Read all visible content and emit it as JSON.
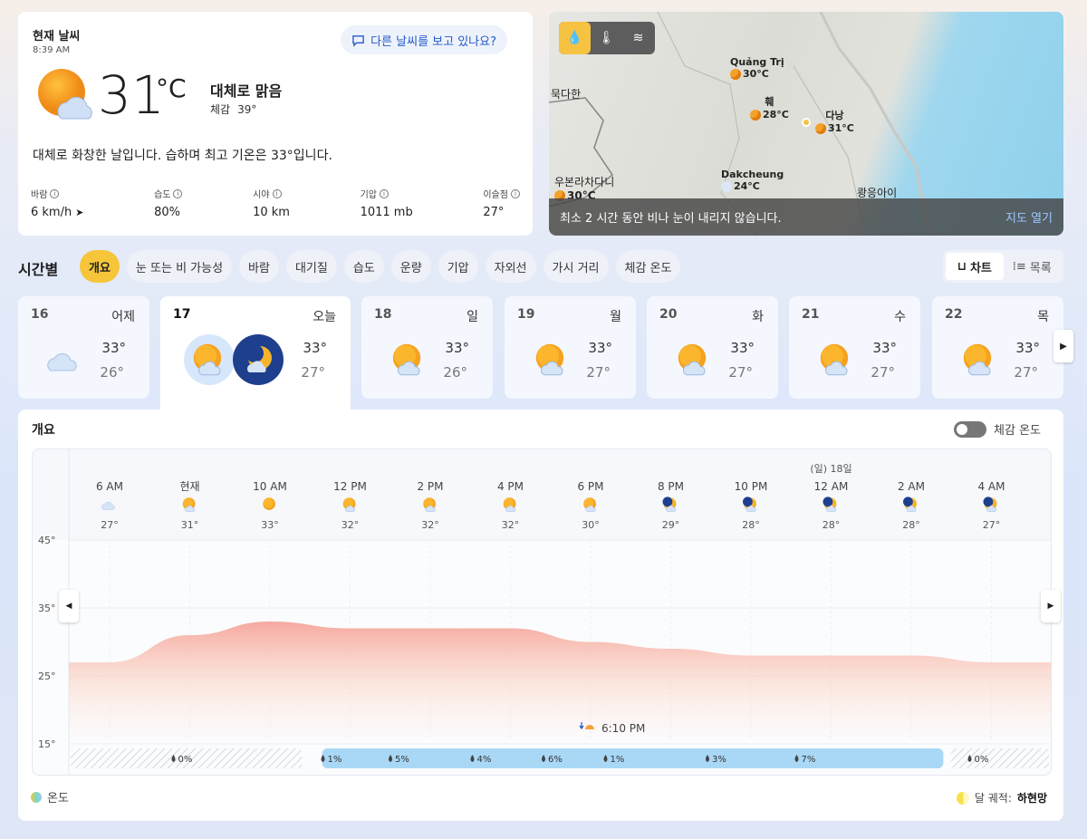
{
  "current": {
    "title": "현재 날씨",
    "time": "8:39 AM",
    "feedback_label": "다른 날씨를 보고 있나요?",
    "temp": "31",
    "unit": "°C",
    "condition": "대체로 맑음",
    "feels_label": "체감",
    "feels_value": "39°",
    "summary": "대체로 화창한 날입니다. 습하며 최고 기온은 33°입니다.",
    "stats": [
      {
        "label": "바람",
        "value": "6 km/h"
      },
      {
        "label": "습도",
        "value": "80%"
      },
      {
        "label": "시야",
        "value": "10 km"
      },
      {
        "label": "기압",
        "value": "1011 mb"
      },
      {
        "label": "이슬점",
        "value": "27°"
      }
    ]
  },
  "map": {
    "cities": [
      {
        "name": "Quảng Trị",
        "temp": "30°C"
      },
      {
        "name": "훼",
        "temp": "28°C"
      },
      {
        "name": "다낭",
        "temp": "31°C"
      },
      {
        "name": "묵다한",
        "temp": ""
      },
      {
        "name": "Dakcheung",
        "temp": "24°C"
      },
      {
        "name": "우본라차다니",
        "temp": "30°C"
      },
      {
        "name": "쾅응아이",
        "temp": ""
      }
    ],
    "footer_text": "최소 2 시간 동안 비나 눈이 내리지 않습니다.",
    "open_label": "지도 열기"
  },
  "hourly": {
    "title": "시간별",
    "pills": [
      "개요",
      "눈 또는 비 가능성",
      "바람",
      "대기질",
      "습도",
      "운량",
      "기압",
      "자외선",
      "가시 거리",
      "체감 온도"
    ],
    "view_chart": "차트",
    "view_list": "목록"
  },
  "days": [
    {
      "num": "16",
      "name": "어제",
      "hi": "33°",
      "lo": "26°",
      "icon": "cloudy"
    },
    {
      "num": "17",
      "name": "오늘",
      "hi": "33°",
      "lo": "27°",
      "icon": "sun-cloud-moon"
    },
    {
      "num": "18",
      "name": "일",
      "hi": "33°",
      "lo": "26°",
      "icon": "sun-cloud"
    },
    {
      "num": "19",
      "name": "월",
      "hi": "33°",
      "lo": "27°",
      "icon": "sun-cloud"
    },
    {
      "num": "20",
      "name": "화",
      "hi": "33°",
      "lo": "27°",
      "icon": "sun-cloud"
    },
    {
      "num": "21",
      "name": "수",
      "hi": "33°",
      "lo": "27°",
      "icon": "sun-cloud"
    },
    {
      "num": "22",
      "name": "목",
      "hi": "33°",
      "lo": "27°",
      "icon": "sun-cloud"
    }
  ],
  "overview": {
    "title": "개요",
    "feels_toggle": "체감 온도",
    "legend_temp": "온도",
    "moon_label": "달 궤적:",
    "moon_phase": "하현망",
    "sunset": "6:10 PM"
  },
  "chart_data": {
    "type": "area",
    "x": [
      "6 AM",
      "현재",
      "10 AM",
      "12 PM",
      "2 PM",
      "4 PM",
      "6 PM",
      "8 PM",
      "10 PM",
      "12 AM",
      "2 AM",
      "4 AM"
    ],
    "day_marker": "(일) 18일",
    "temps": [
      27,
      31,
      33,
      32,
      32,
      32,
      30,
      29,
      28,
      28,
      28,
      27
    ],
    "temp_labels": [
      "27°",
      "31°",
      "33°",
      "32°",
      "32°",
      "32°",
      "30°",
      "29°",
      "28°",
      "28°",
      "28°",
      "27°"
    ],
    "icons": [
      "cloudy",
      "sun-cloud",
      "sun",
      "sun-cloud",
      "sun-cloud",
      "sun-cloud",
      "sun-cloud",
      "moon-cloud",
      "moon-cloud",
      "moon-cloud",
      "moon-cloud",
      "moon-cloud"
    ],
    "ylim": [
      15,
      45
    ],
    "yticks": [
      "45°",
      "35°",
      "25°",
      "15°"
    ],
    "precip": [
      "0%",
      "1%",
      "5%",
      "4%",
      "6%",
      "1%",
      "3%",
      "7%",
      "0%"
    ]
  }
}
